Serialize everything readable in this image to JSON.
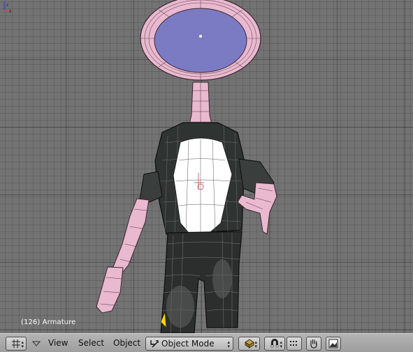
{
  "viewport": {
    "status": "(126) Armature",
    "axis_labels": {
      "x": "x",
      "z": "z"
    }
  },
  "header": {
    "menus": [
      {
        "label": "View"
      },
      {
        "label": "Select"
      },
      {
        "label": "Object"
      }
    ],
    "mode": {
      "selected": "Object Mode",
      "icon": "object-mode-icon"
    },
    "icons": [
      "grid-window-type-icon",
      "collapse-arrow-icon",
      "draw-type-icon",
      "magnet-snap-icon",
      "snap-dots-icon",
      "hand-grab-icon",
      "render-image-icon"
    ]
  }
}
